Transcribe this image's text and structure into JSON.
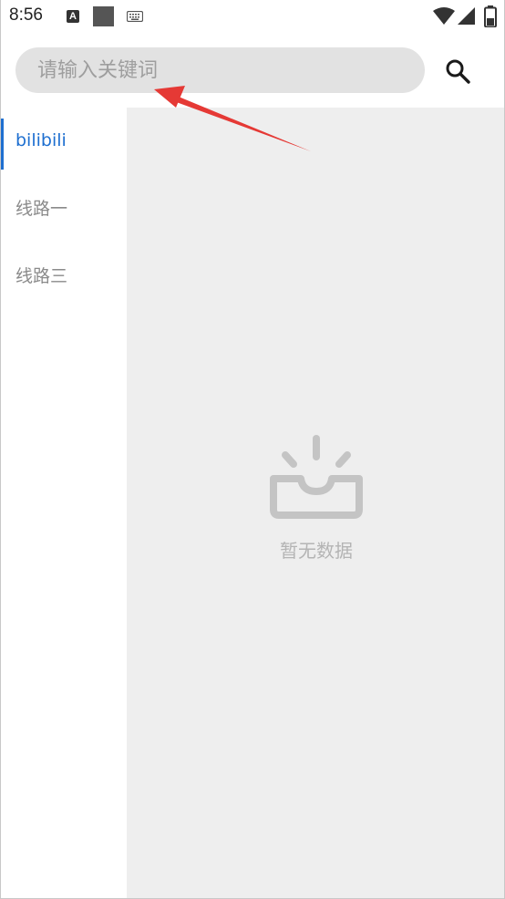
{
  "status_bar": {
    "time": "8:56",
    "icons": [
      "a-icon",
      "square-icon",
      "keyboard-icon",
      "wifi-icon",
      "signal-icon",
      "battery-icon"
    ],
    "a_icon_letter": "A"
  },
  "search": {
    "placeholder": "请输入关键词",
    "value": "",
    "button_icon": "search-icon"
  },
  "sidebar": {
    "items": [
      {
        "label": "bilibili",
        "active": true
      },
      {
        "label": "线路一",
        "active": false
      },
      {
        "label": "线路三",
        "active": false
      }
    ]
  },
  "content": {
    "empty_icon": "inbox-icon",
    "empty_text": "暂无数据"
  },
  "colors": {
    "accent": "#1e6fd0",
    "inactive_text": "#8a8a8a",
    "search_bg": "#e2e2e2",
    "content_bg": "#eeeeee",
    "empty_icon": "#c4c4c4",
    "annotation": "#e53935"
  }
}
